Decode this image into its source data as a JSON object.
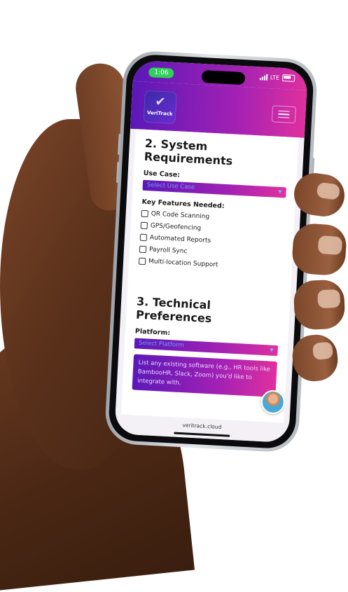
{
  "status_bar": {
    "time": "1:06",
    "network": "LTE"
  },
  "header": {
    "logo_brand": "VeriTrack",
    "logo_icon": "check-badge-icon",
    "menu_icon": "hamburger-icon"
  },
  "section2": {
    "title_line1": "2. System",
    "title_line2": "Requirements",
    "use_case_label": "Use Case:",
    "use_case_value": "Select Use Case",
    "features_label": "Key Features Needed:",
    "features": [
      "QR Code Scanning",
      "GPS/Geofencing",
      "Automated Reports",
      "Payroll Sync",
      "Multi-location Support"
    ]
  },
  "section3": {
    "title_line1": "3. Technical",
    "title_line2": "Preferences",
    "platform_label": "Platform:",
    "platform_value": "Select Platform",
    "integrations_placeholder": "List any existing software (e.g., HR tools like BambooHR, Slack, Zoom) you'd like to integrate with."
  },
  "browser": {
    "url": "veritrack.cloud"
  },
  "colors": {
    "gradient_start": "#5b18b8",
    "gradient_mid": "#a221b4",
    "gradient_end": "#e0309e",
    "time_pill": "#2fd158"
  }
}
